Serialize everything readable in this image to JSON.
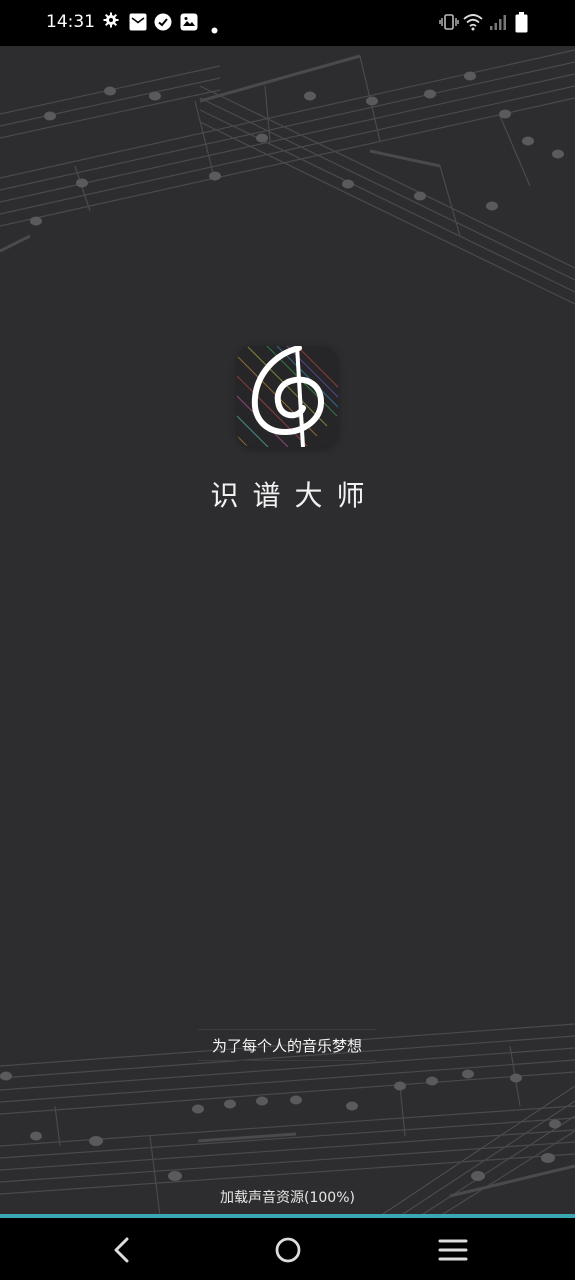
{
  "status_bar": {
    "time": "14:31",
    "left_icons": [
      "gear-icon",
      "mail-icon",
      "check-circle-icon",
      "picture-icon",
      "dot-icon"
    ],
    "right_icons": [
      "vibrate-icon",
      "wifi-icon",
      "signal-icon",
      "battery-icon"
    ]
  },
  "splash": {
    "app_title": "识谱大师",
    "logo_icon": "treble-clef-icon",
    "slogan": "为了每个人的音乐梦想",
    "loading_text": "加载声音资源(100%)",
    "progress": 1.0,
    "accent_color": "#3aa8b4",
    "background_color": "#2d2d2f"
  },
  "nav_bar": {
    "buttons": [
      "back-icon",
      "home-icon",
      "menu-icon"
    ]
  }
}
